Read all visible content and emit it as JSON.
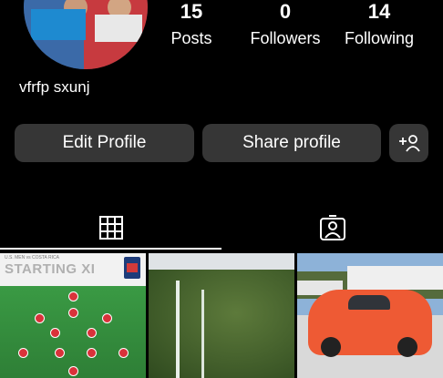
{
  "profile": {
    "username": "vfrfp sxunj"
  },
  "stats": [
    {
      "count": "15",
      "label": "Posts"
    },
    {
      "count": "0",
      "label": "Followers"
    },
    {
      "count": "14",
      "label": "Following"
    }
  ],
  "actions": {
    "edit_label": "Edit Profile",
    "share_label": "Share profile"
  },
  "tabs": [
    {
      "icon": "grid-icon",
      "active": true
    },
    {
      "icon": "tagged-icon",
      "active": false
    }
  ],
  "posts": [
    {
      "title": "STARTING XI",
      "caption_top": "U.S. MEN vs COSTA RICA"
    },
    {
      "icon": "waterfall-photo"
    },
    {
      "icon": "car-photo"
    }
  ],
  "colors": {
    "background": "#000000",
    "button": "#363636",
    "text": "#ffffff"
  }
}
